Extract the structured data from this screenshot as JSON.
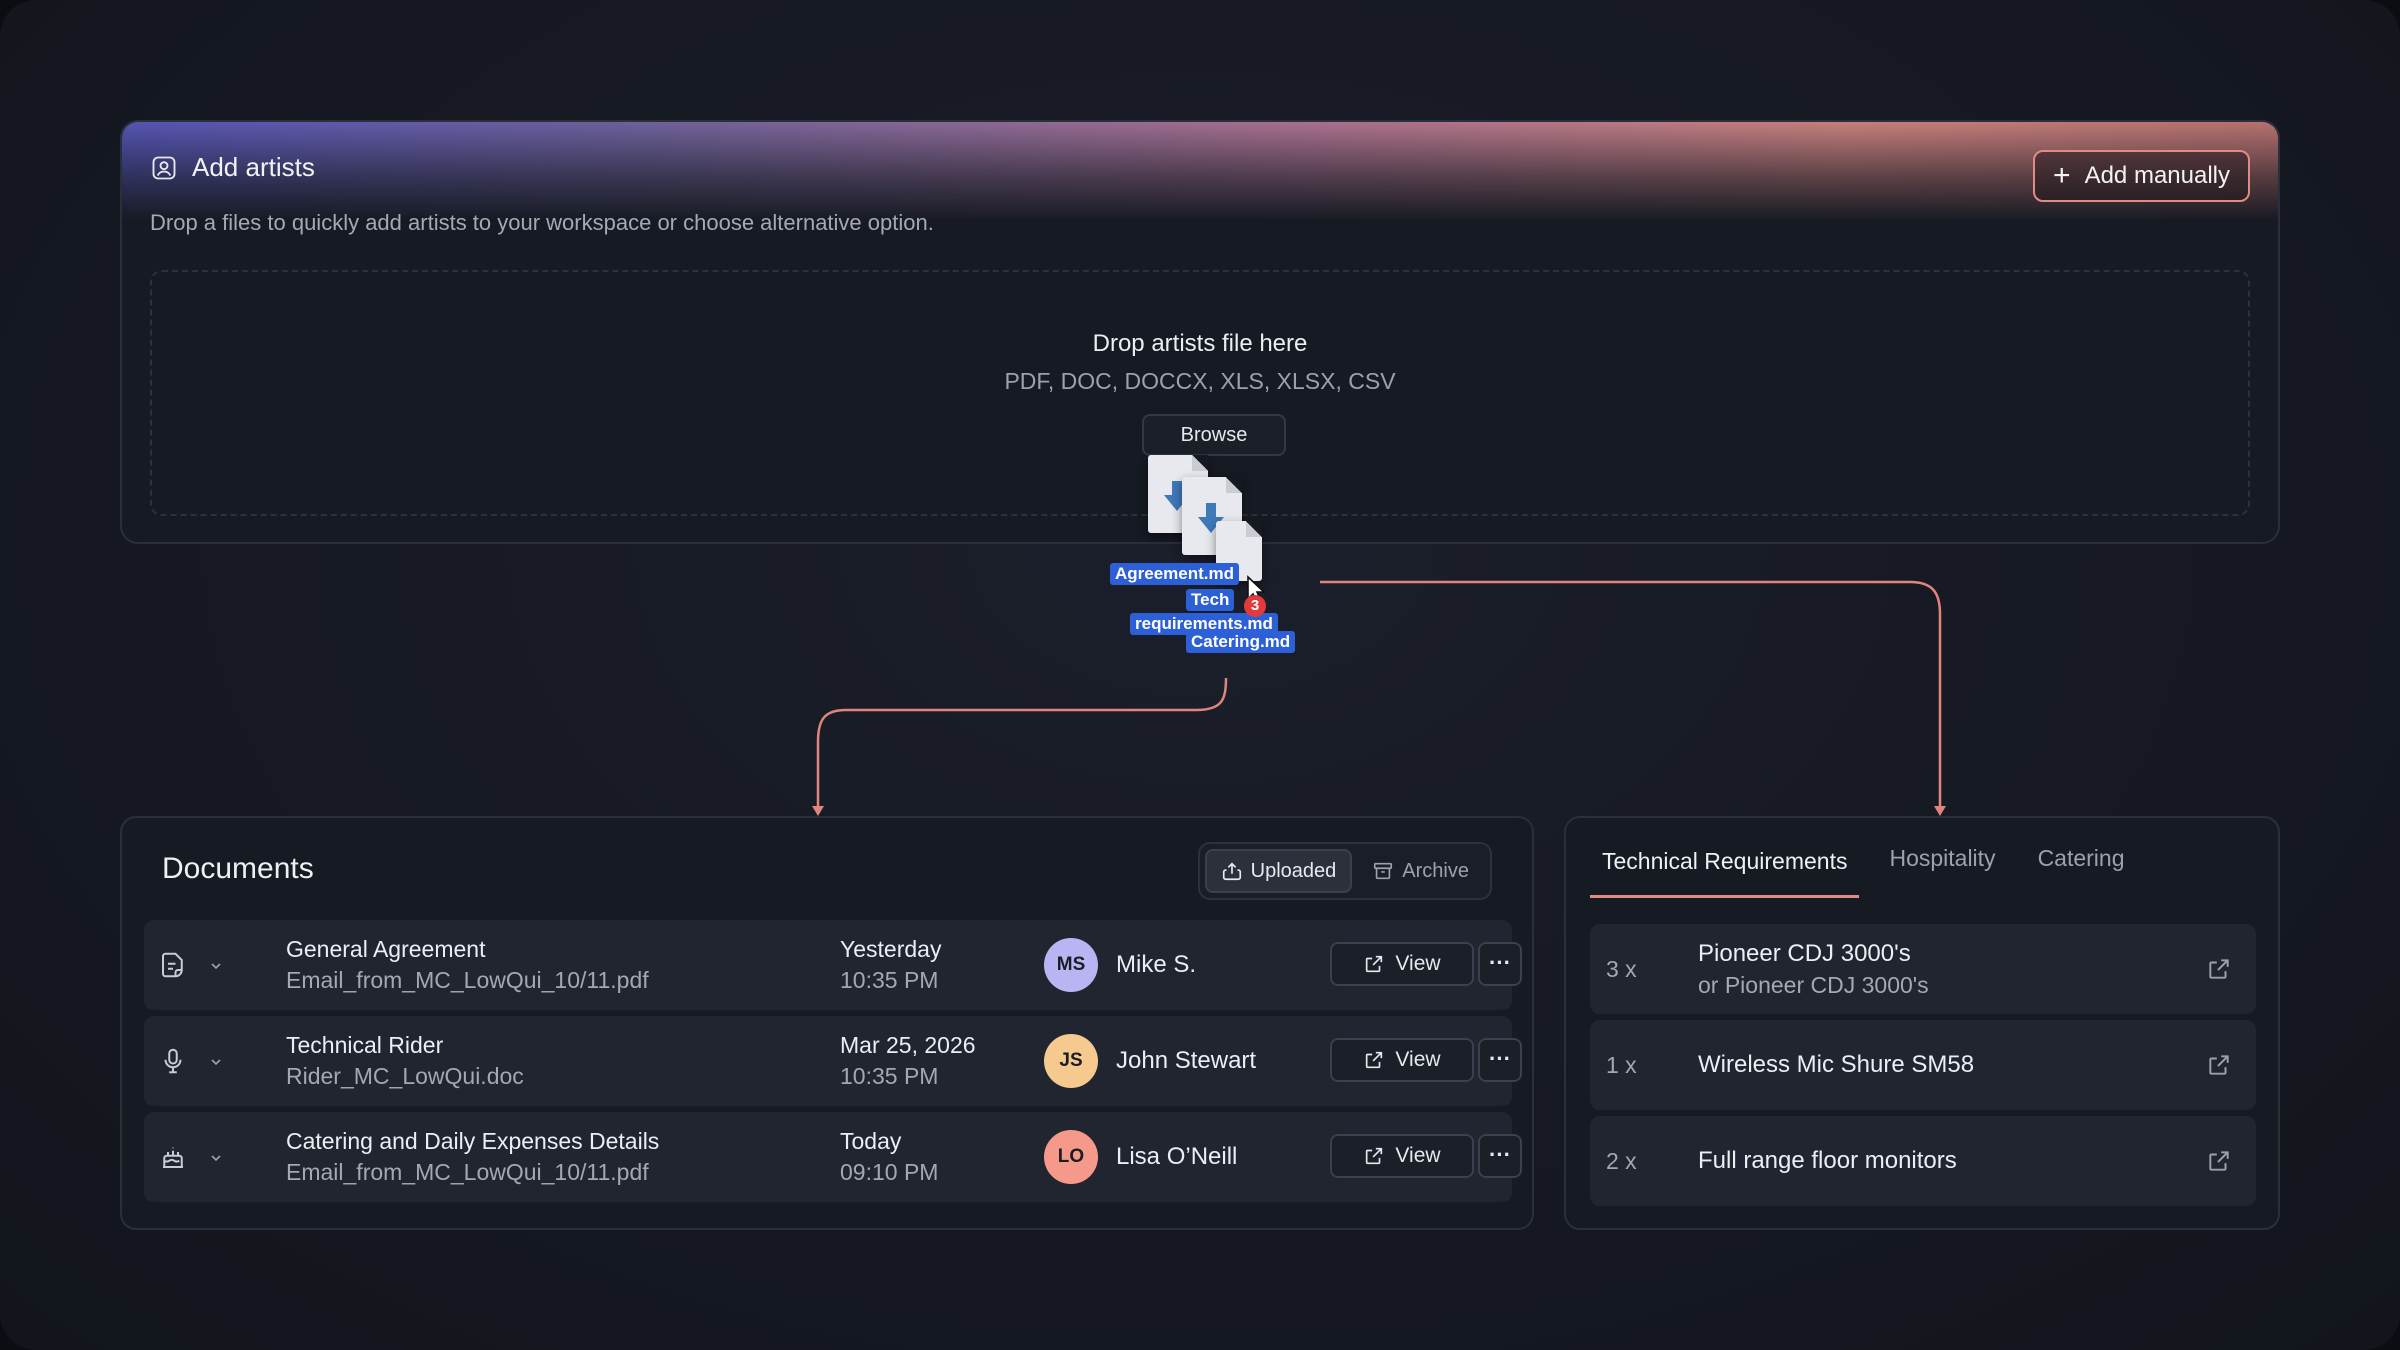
{
  "artists": {
    "title": "Add artists",
    "add_manually_label": "Add manually",
    "subtitle": "Drop a files to quickly add artists to your workspace or choose alternative option.",
    "dropzone_title": "Drop artists file here",
    "dropzone_types": "PDF, DOC, DOCCX, XLS, XLSX, CSV",
    "browse_label": "Browse"
  },
  "dragged_files": {
    "labels": [
      "Agreement.md",
      "Tech",
      "requirements.md",
      "Catering.md"
    ],
    "count": "3"
  },
  "documents": {
    "title": "Documents",
    "segments": [
      {
        "label": "Uploaded",
        "icon": "upload-icon",
        "active": true
      },
      {
        "label": "Archive",
        "icon": "archive-icon",
        "active": false
      }
    ],
    "view_label": "View",
    "rows": [
      {
        "name": "General Agreement",
        "file": "Email_from_MC_LowQui_10/11.pdf",
        "date": "Yesterday",
        "time": "10:35 PM",
        "initials": "MS",
        "person": "Mike S.",
        "avatar_color": "#b9b5f3",
        "icon": "document-icon"
      },
      {
        "name": "Technical Rider",
        "file": "Rider_MC_LowQui.doc",
        "date": "Mar 25, 2026",
        "time": "10:35 PM",
        "initials": "JS",
        "person": "John Stewart",
        "avatar_color": "#f6c98f",
        "icon": "microphone-icon"
      },
      {
        "name": "Catering and Daily Expenses Details",
        "file": "Email_from_MC_LowQui_10/11.pdf",
        "date": "Today",
        "time": "09:10 PM",
        "initials": "LO",
        "person": "Lisa O’Neill",
        "avatar_color": "#f59a8a",
        "icon": "cake-icon"
      }
    ]
  },
  "requirements": {
    "tabs": [
      {
        "label": "Technical Requirements",
        "active": true
      },
      {
        "label": "Hospitality",
        "active": false
      },
      {
        "label": "Catering",
        "active": false
      }
    ],
    "items": [
      {
        "qty": "3 x",
        "name": "Pioneer CDJ 3000's",
        "alt": "or Pioneer CDJ 3000's"
      },
      {
        "qty": "1 x",
        "name": "Wireless Mic Shure SM58",
        "alt": ""
      },
      {
        "qty": "2 x",
        "name": "Full range floor monitors",
        "alt": ""
      }
    ]
  },
  "colors": {
    "accent": "#e28a84",
    "connector": "#e0857e",
    "file_label": "#2d5fd6"
  }
}
